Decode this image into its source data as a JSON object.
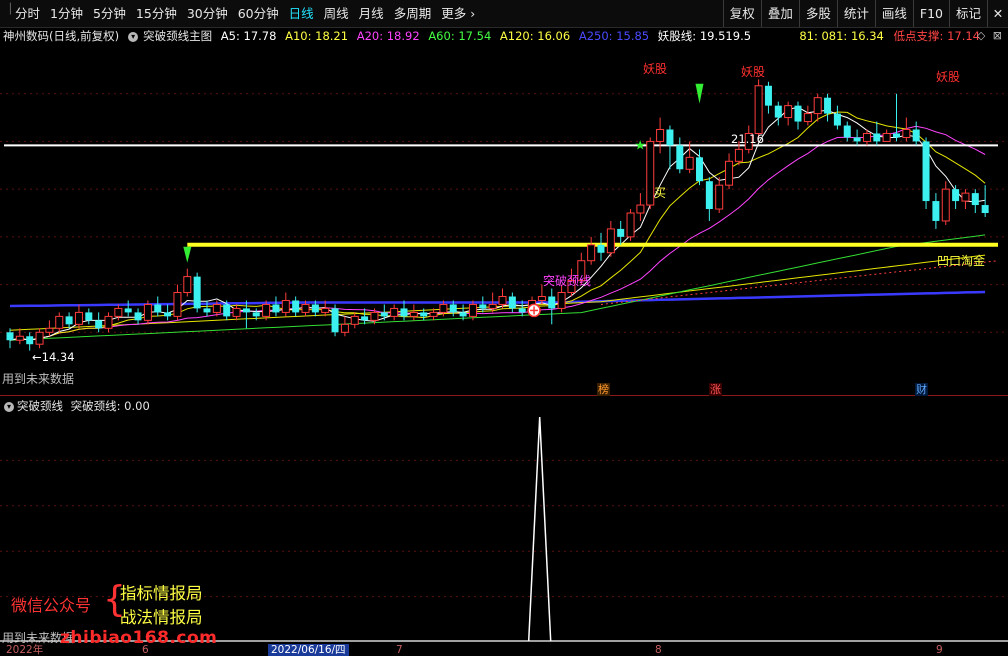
{
  "toolbar": {
    "periods": [
      "分时",
      "1分钟",
      "5分钟",
      "15分钟",
      "30分钟",
      "60分钟",
      "日线",
      "周线",
      "月线",
      "多周期",
      "更多"
    ],
    "active_period": "日线",
    "tools": [
      "复权",
      "叠加",
      "多股",
      "统计",
      "画线",
      "F10",
      "标记"
    ]
  },
  "header": {
    "stock_name": "神州数码(日线,前复权)",
    "indicator_name": "突破颈线主图",
    "ma": [
      {
        "label": "A5: 17.78",
        "color": "#ffffff"
      },
      {
        "label": "A10: 18.21",
        "color": "#ffff44"
      },
      {
        "label": "A20: 18.92",
        "color": "#ff44ff"
      },
      {
        "label": "A60: 17.54",
        "color": "#44ff44"
      },
      {
        "label": "A120: 16.06",
        "color": "#ffff44"
      },
      {
        "label": "A250: 15.85",
        "color": "#4a4aff"
      }
    ],
    "yaogu_line": "妖股线: 19.519.5",
    "right_values": [
      {
        "label": "81: 081: 16.34",
        "color": "#ffff44"
      },
      {
        "label": "低点支撑: 17.14",
        "color": "#ff4444"
      }
    ]
  },
  "chart_labels": {
    "yaogu": "妖股",
    "high_price": "21.16",
    "low_price": "14.34",
    "buy": "买",
    "tupo": "突破颈线",
    "taojin": "凹口淘金",
    "future_data": "用到未来数据",
    "badge_bang": "榜",
    "badge_zhang": "涨",
    "badge_cai": "财"
  },
  "sub_indicator": {
    "name": "突破颈线",
    "value_label": "突破颈线: 0.00"
  },
  "watermark": {
    "wechat": "微信公众号",
    "name1": "指标情报局",
    "name2": "战法情报局",
    "site": "zhibiao168.com",
    "future_data2": "用到未来数据"
  },
  "date_axis": {
    "year": "2022年",
    "m6": "6",
    "selected": "2022/06/16/四",
    "m7": "7",
    "m8": "8",
    "m9": "9"
  },
  "chart_data": {
    "type": "candlestick",
    "candles": [
      [
        14.8,
        14.6,
        14.9,
        14.4
      ],
      [
        14.6,
        14.7,
        14.9,
        14.5
      ],
      [
        14.7,
        14.5,
        14.8,
        14.34
      ],
      [
        14.5,
        14.8,
        14.9,
        14.4
      ],
      [
        14.8,
        14.9,
        15.1,
        14.7
      ],
      [
        14.9,
        15.2,
        15.3,
        14.8
      ],
      [
        15.2,
        15.0,
        15.3,
        14.9
      ],
      [
        15.0,
        15.3,
        15.5,
        14.9
      ],
      [
        15.3,
        15.1,
        15.4,
        15.0
      ],
      [
        15.1,
        14.9,
        15.3,
        14.8
      ],
      [
        14.9,
        15.2,
        15.3,
        14.8
      ],
      [
        15.2,
        15.4,
        15.5,
        15.1
      ],
      [
        15.4,
        15.3,
        15.6,
        15.2
      ],
      [
        15.3,
        15.1,
        15.4,
        15.0
      ],
      [
        15.1,
        15.5,
        15.6,
        15.0
      ],
      [
        15.5,
        15.3,
        15.7,
        15.2
      ],
      [
        15.3,
        15.2,
        15.5,
        15.1
      ],
      [
        15.2,
        15.8,
        16.0,
        15.1
      ],
      [
        15.8,
        16.2,
        16.4,
        15.7
      ],
      [
        16.2,
        15.4,
        16.3,
        15.3
      ],
      [
        15.4,
        15.3,
        15.6,
        15.2
      ],
      [
        15.3,
        15.5,
        15.6,
        15.2
      ],
      [
        15.5,
        15.2,
        15.6,
        15.1
      ],
      [
        15.2,
        15.4,
        15.5,
        15.1
      ],
      [
        15.4,
        15.3,
        15.6,
        14.9
      ],
      [
        15.3,
        15.2,
        15.4,
        15.1
      ],
      [
        15.2,
        15.5,
        15.6,
        15.1
      ],
      [
        15.5,
        15.3,
        15.7,
        15.2
      ],
      [
        15.3,
        15.6,
        15.8,
        15.2
      ],
      [
        15.6,
        15.3,
        15.7,
        15.2
      ],
      [
        15.3,
        15.5,
        15.6,
        15.2
      ],
      [
        15.5,
        15.3,
        15.6,
        15.2
      ],
      [
        15.3,
        15.4,
        15.6,
        15.2
      ],
      [
        15.4,
        14.8,
        15.5,
        14.7
      ],
      [
        14.8,
        15.0,
        15.2,
        14.7
      ],
      [
        15.0,
        15.2,
        15.3,
        14.9
      ],
      [
        15.2,
        15.1,
        15.4,
        15.0
      ],
      [
        15.1,
        15.3,
        15.4,
        15.0
      ],
      [
        15.3,
        15.2,
        15.5,
        15.1
      ],
      [
        15.2,
        15.4,
        15.5,
        15.1
      ],
      [
        15.4,
        15.2,
        15.6,
        15.1
      ],
      [
        15.2,
        15.3,
        15.5,
        15.1
      ],
      [
        15.3,
        15.2,
        15.4,
        15.1
      ],
      [
        15.2,
        15.3,
        15.4,
        15.1
      ],
      [
        15.3,
        15.5,
        15.6,
        15.2
      ],
      [
        15.5,
        15.3,
        15.6,
        15.2
      ],
      [
        15.3,
        15.2,
        15.5,
        15.1
      ],
      [
        15.2,
        15.5,
        15.6,
        15.1
      ],
      [
        15.5,
        15.4,
        15.7,
        15.3
      ],
      [
        15.4,
        15.5,
        15.8,
        15.3
      ],
      [
        15.5,
        15.7,
        15.9,
        15.4
      ],
      [
        15.7,
        15.4,
        15.8,
        15.3
      ],
      [
        15.4,
        15.3,
        15.6,
        15.2
      ],
      [
        15.3,
        15.6,
        15.7,
        15.2
      ],
      [
        15.6,
        15.7,
        16.0,
        15.5
      ],
      [
        15.7,
        15.4,
        15.9,
        15.0
      ],
      [
        15.4,
        15.8,
        16.0,
        15.3
      ],
      [
        15.8,
        16.1,
        16.4,
        15.7
      ],
      [
        16.1,
        16.6,
        16.8,
        16.0
      ],
      [
        16.6,
        17.0,
        17.2,
        16.5
      ],
      [
        17.0,
        16.8,
        17.3,
        16.6
      ],
      [
        16.8,
        17.4,
        17.6,
        16.7
      ],
      [
        17.4,
        17.2,
        17.6,
        17.0
      ],
      [
        17.2,
        17.8,
        17.9,
        17.1
      ],
      [
        17.8,
        18.0,
        18.3,
        17.6
      ],
      [
        18.0,
        19.6,
        19.7,
        17.9
      ],
      [
        19.6,
        19.9,
        20.2,
        19.3
      ],
      [
        19.9,
        19.5,
        20.0,
        18.9
      ],
      [
        19.5,
        18.9,
        19.7,
        18.8
      ],
      [
        18.9,
        19.2,
        19.6,
        18.8
      ],
      [
        19.2,
        18.6,
        19.4,
        18.5
      ],
      [
        18.6,
        17.9,
        18.7,
        17.6
      ],
      [
        17.9,
        18.5,
        18.7,
        17.8
      ],
      [
        18.5,
        19.1,
        19.3,
        18.4
      ],
      [
        19.1,
        19.4,
        19.6,
        19.0
      ],
      [
        19.4,
        19.8,
        20.0,
        19.3
      ],
      [
        19.8,
        21.0,
        21.16,
        19.7
      ],
      [
        21.0,
        20.5,
        21.1,
        20.3
      ],
      [
        20.5,
        20.2,
        20.6,
        20.0
      ],
      [
        20.2,
        20.5,
        20.6,
        20.0
      ],
      [
        20.5,
        20.1,
        20.6,
        19.9
      ],
      [
        20.1,
        20.3,
        20.5,
        20.0
      ],
      [
        20.3,
        20.7,
        20.8,
        20.1
      ],
      [
        20.7,
        20.3,
        20.8,
        20.1
      ],
      [
        20.3,
        20.0,
        20.5,
        19.9
      ],
      [
        20.0,
        19.7,
        20.1,
        19.6
      ],
      [
        19.7,
        19.6,
        19.9,
        19.5
      ],
      [
        19.6,
        19.8,
        19.9,
        19.5
      ],
      [
        19.8,
        19.6,
        20.1,
        19.5
      ],
      [
        19.6,
        19.8,
        19.9,
        19.6
      ],
      [
        19.8,
        19.7,
        20.8,
        19.6
      ],
      [
        19.7,
        19.9,
        20.2,
        19.6
      ],
      [
        19.9,
        19.6,
        20.1,
        19.5
      ],
      [
        19.6,
        18.1,
        19.7,
        17.9
      ],
      [
        18.1,
        17.6,
        18.3,
        17.4
      ],
      [
        17.6,
        18.4,
        18.6,
        17.5
      ],
      [
        18.4,
        18.1,
        18.5,
        17.9
      ],
      [
        18.1,
        18.3,
        18.4,
        17.9
      ],
      [
        18.3,
        18.0,
        18.4,
        17.8
      ],
      [
        18.0,
        17.8,
        18.5,
        17.7
      ]
    ],
    "yaogu_level": 19.5,
    "neckline": 17.0,
    "ylim": [
      13.6,
      22.0
    ],
    "sub_signal": {
      "index": 62,
      "value": 1.0,
      "baseline": 0.0
    }
  }
}
